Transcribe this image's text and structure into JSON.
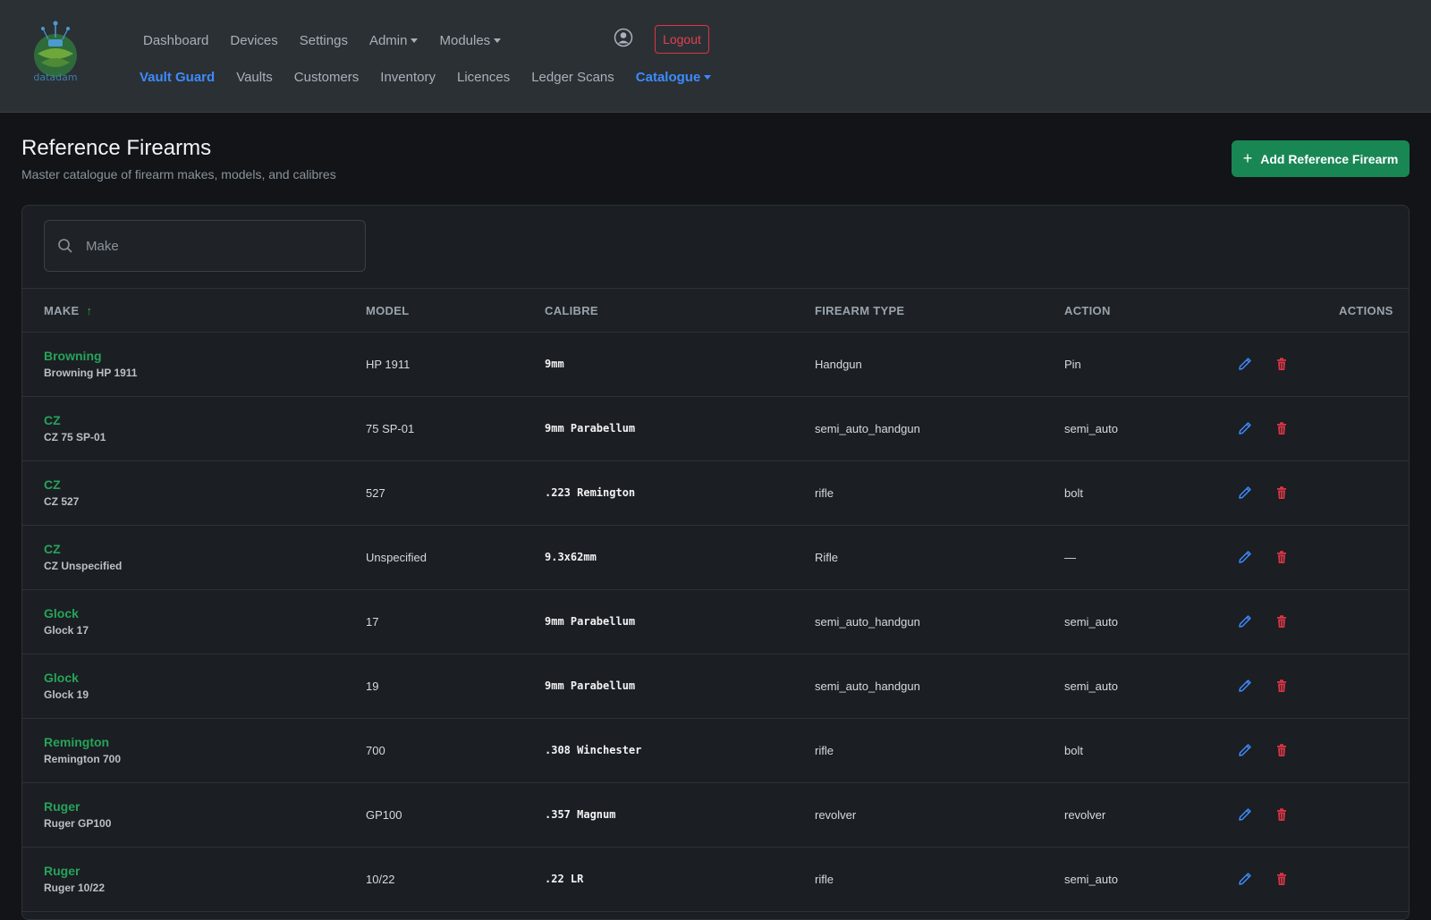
{
  "brand": {
    "logo_text": "datadam"
  },
  "nav": {
    "primary": [
      {
        "label": "Dashboard",
        "dropdown": false
      },
      {
        "label": "Devices",
        "dropdown": false
      },
      {
        "label": "Settings",
        "dropdown": false
      },
      {
        "label": "Admin",
        "dropdown": true
      },
      {
        "label": "Modules",
        "dropdown": true
      }
    ],
    "secondary": [
      {
        "label": "Vault Guard",
        "active": true
      },
      {
        "label": "Vaults"
      },
      {
        "label": "Customers"
      },
      {
        "label": "Inventory"
      },
      {
        "label": "Licences"
      },
      {
        "label": "Ledger Scans"
      },
      {
        "label": "Catalogue",
        "active": true,
        "dropdown": true
      }
    ],
    "user_icon": "user-circle-icon",
    "logout_label": "Logout"
  },
  "page": {
    "title": "Reference Firearms",
    "subtitle": "Master catalogue of firearm makes, models, and calibres",
    "add_button_label": "Add Reference Firearm"
  },
  "search": {
    "placeholder": "Make",
    "value": ""
  },
  "table": {
    "columns": {
      "make": "MAKE",
      "model": "MODEL",
      "calibre": "CALIBRE",
      "firearm_type": "FIREARM TYPE",
      "action": "ACTION",
      "actions": "ACTIONS"
    },
    "sort": {
      "column": "make",
      "direction": "asc"
    },
    "rows": [
      {
        "make": "Browning",
        "full_name": "Browning HP 1911",
        "model": "HP 1911",
        "calibre": "9mm",
        "firearm_type": "Handgun",
        "action": "Pin"
      },
      {
        "make": "CZ",
        "full_name": "CZ 75 SP-01",
        "model": "75 SP-01",
        "calibre": "9mm Parabellum",
        "firearm_type": "semi_auto_handgun",
        "action": "semi_auto"
      },
      {
        "make": "CZ",
        "full_name": "CZ 527",
        "model": "527",
        "calibre": ".223 Remington",
        "firearm_type": "rifle",
        "action": "bolt"
      },
      {
        "make": "CZ",
        "full_name": "CZ Unspecified",
        "model": "Unspecified",
        "calibre": "9.3x62mm",
        "firearm_type": "Rifle",
        "action": "—"
      },
      {
        "make": "Glock",
        "full_name": "Glock 17",
        "model": "17",
        "calibre": "9mm Parabellum",
        "firearm_type": "semi_auto_handgun",
        "action": "semi_auto"
      },
      {
        "make": "Glock",
        "full_name": "Glock 19",
        "model": "19",
        "calibre": "9mm Parabellum",
        "firearm_type": "semi_auto_handgun",
        "action": "semi_auto"
      },
      {
        "make": "Remington",
        "full_name": "Remington 700",
        "model": "700",
        "calibre": ".308 Winchester",
        "firearm_type": "rifle",
        "action": "bolt"
      },
      {
        "make": "Ruger",
        "full_name": "Ruger GP100",
        "model": "GP100",
        "calibre": ".357 Magnum",
        "firearm_type": "revolver",
        "action": "revolver"
      },
      {
        "make": "Ruger",
        "full_name": "Ruger 10/22",
        "model": "10/22",
        "calibre": ".22 LR",
        "firearm_type": "rifle",
        "action": "semi_auto"
      }
    ]
  },
  "colors": {
    "accent": "#3d8bfd",
    "success": "#198754",
    "danger": "#dc3545",
    "make_link": "#25a45a"
  }
}
